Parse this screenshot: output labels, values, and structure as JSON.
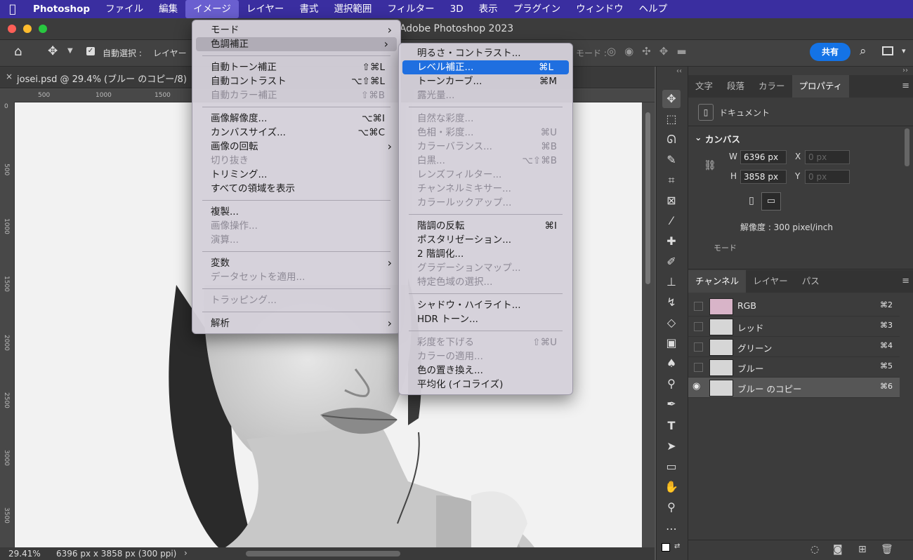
{
  "menubar": {
    "app_name": "Photoshop",
    "items": [
      "ファイル",
      "編集",
      "イメージ",
      "レイヤー",
      "書式",
      "選択範囲",
      "フィルター",
      "3D",
      "表示",
      "プラグイン",
      "ウィンドウ",
      "ヘルプ"
    ],
    "active": "イメージ"
  },
  "window": {
    "title": "Adobe Photoshop 2023"
  },
  "options": {
    "auto_select_label": "自動選択 :",
    "auto_select_value": "レイヤー",
    "mode_label": "モード :",
    "share_label": "共有"
  },
  "document": {
    "tab_label": "josei.psd @ 29.4% (ブルー のコピー/8)",
    "h_ruler": [
      "500",
      "1000",
      "1500"
    ],
    "v_ruler": [
      "0",
      "500",
      "1000",
      "1500",
      "2000",
      "2500",
      "3000",
      "3500"
    ]
  },
  "status": {
    "zoom": "29.41%",
    "info": "6396 px x 3858 px (300 ppi)"
  },
  "image_menu": {
    "groups": [
      [
        {
          "label": "モード",
          "submenu": true
        },
        {
          "label": "色調補正",
          "submenu": true,
          "highlight": true
        }
      ],
      [
        {
          "label": "自動トーン補正",
          "shortcut": "⇧⌘L"
        },
        {
          "label": "自動コントラスト",
          "shortcut": "⌥⇧⌘L"
        },
        {
          "label": "自動カラー補正",
          "shortcut": "⇧⌘B",
          "disabled": true
        }
      ],
      [
        {
          "label": "画像解像度...",
          "shortcut": "⌥⌘I"
        },
        {
          "label": "カンバスサイズ...",
          "shortcut": "⌥⌘C"
        },
        {
          "label": "画像の回転",
          "submenu": true
        },
        {
          "label": "切り抜き",
          "disabled": true
        },
        {
          "label": "トリミング..."
        },
        {
          "label": "すべての領域を表示"
        }
      ],
      [
        {
          "label": "複製..."
        },
        {
          "label": "画像操作...",
          "disabled": true
        },
        {
          "label": "演算...",
          "disabled": true
        }
      ],
      [
        {
          "label": "変数",
          "submenu": true
        },
        {
          "label": "データセットを適用...",
          "disabled": true
        }
      ],
      [
        {
          "label": "トラッピング...",
          "disabled": true
        }
      ],
      [
        {
          "label": "解析",
          "submenu": true
        }
      ]
    ]
  },
  "adjust_menu": {
    "groups": [
      [
        {
          "label": "明るさ・コントラスト..."
        },
        {
          "label": "レベル補正...",
          "shortcut": "⌘L",
          "selected": true
        },
        {
          "label": "トーンカーブ...",
          "shortcut": "⌘M"
        },
        {
          "label": "露光量...",
          "disabled": true
        }
      ],
      [
        {
          "label": "自然な彩度...",
          "disabled": true
        },
        {
          "label": "色相・彩度...",
          "shortcut": "⌘U",
          "disabled": true
        },
        {
          "label": "カラーバランス...",
          "shortcut": "⌘B",
          "disabled": true
        },
        {
          "label": "白黒...",
          "shortcut": "⌥⇧⌘B",
          "disabled": true
        },
        {
          "label": "レンズフィルター...",
          "disabled": true
        },
        {
          "label": "チャンネルミキサー...",
          "disabled": true
        },
        {
          "label": "カラールックアップ...",
          "disabled": true
        }
      ],
      [
        {
          "label": "階調の反転",
          "shortcut": "⌘I"
        },
        {
          "label": "ポスタリゼーション..."
        },
        {
          "label": "2 階調化..."
        },
        {
          "label": "グラデーションマップ...",
          "disabled": true
        },
        {
          "label": "特定色域の選択...",
          "disabled": true
        }
      ],
      [
        {
          "label": "シャドウ・ハイライト..."
        },
        {
          "label": "HDR トーン..."
        }
      ],
      [
        {
          "label": "彩度を下げる",
          "shortcut": "⇧⌘U",
          "disabled": true
        },
        {
          "label": "カラーの適用...",
          "disabled": true
        },
        {
          "label": "色の置き換え..."
        },
        {
          "label": "平均化 (イコライズ)"
        }
      ]
    ]
  },
  "properties_panel": {
    "tabs": [
      "文字",
      "段落",
      "カラー",
      "プロパティ"
    ],
    "active_tab": "プロパティ",
    "doc_label": "ドキュメント",
    "section": "カンバス",
    "w_label": "W",
    "w_value": "6396 px",
    "h_label": "H",
    "h_value": "3858 px",
    "x_label": "X",
    "x_placeholder": "0 px",
    "y_label": "Y",
    "y_placeholder": "0 px",
    "resolution": "解像度 : 300 pixel/inch",
    "mode_label": "モード"
  },
  "channels_panel": {
    "tabs": [
      "チャンネル",
      "レイヤー",
      "パス"
    ],
    "active_tab": "チャンネル",
    "rows": [
      {
        "name": "RGB",
        "shortcut": "⌘2"
      },
      {
        "name": "レッド",
        "shortcut": "⌘3"
      },
      {
        "name": "グリーン",
        "shortcut": "⌘4"
      },
      {
        "name": "ブルー",
        "shortcut": "⌘5"
      },
      {
        "name": "ブルー のコピー",
        "shortcut": "⌘6",
        "selected": true
      }
    ]
  },
  "colors": {
    "menubar": "#3a2ea0",
    "accent": "#1473e6",
    "highlight": "#1f6fe0"
  }
}
